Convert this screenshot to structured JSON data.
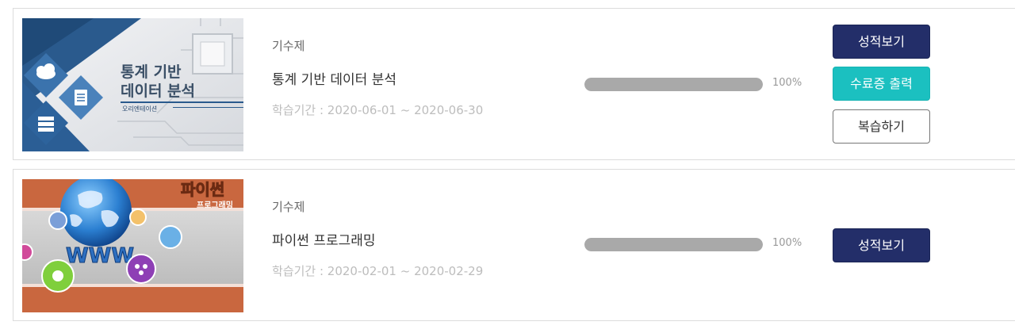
{
  "courses": [
    {
      "thumbnail": {
        "title_line1": "통계 기반",
        "title_line2": "데이터 분석",
        "subtitle": "오리엔테이션"
      },
      "type": "기수제",
      "title": "통계 기반 데이터 분석",
      "period": "학습기간 : 2020-06-01 ~ 2020-06-30",
      "progress_text": "100%",
      "progress_fraction": 1.0,
      "buttons": {
        "grade": "성적보기",
        "certificate": "수료증 출력",
        "review": "복습하기"
      }
    },
    {
      "thumbnail": {
        "title_line1": "파이썬",
        "title_line2": "프로그래밍",
        "globe_text": "WWW"
      },
      "type": "기수제",
      "title": "파이썬 프로그래밍",
      "period": "학습기간 : 2020-02-01 ~ 2020-02-29",
      "progress_text": "100%",
      "progress_fraction": 1.0,
      "buttons": {
        "grade": "성적보기"
      }
    }
  ],
  "colors": {
    "navy_button": "#232e69",
    "teal_button": "#1bc0c0",
    "progress_fill": "#a9a9a9"
  }
}
